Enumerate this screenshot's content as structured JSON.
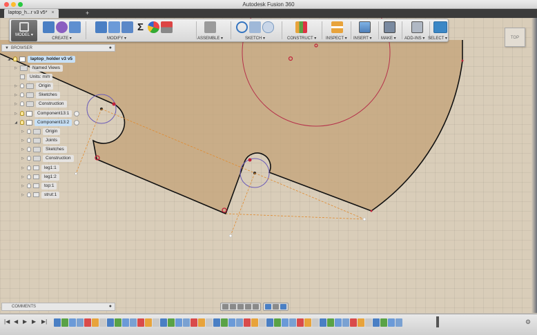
{
  "window": {
    "title": "Autodesk Fusion 360"
  },
  "tab": {
    "label": "laptop_h...r v3 v5*",
    "close": "×",
    "add": "+"
  },
  "toolbar": {
    "workspace": "MODEL ▾",
    "groups": [
      {
        "label": "CREATE ▾"
      },
      {
        "label": "MODIFY ▾"
      },
      {
        "label": "ASSEMBLE ▾"
      },
      {
        "label": "SKETCH ▾"
      },
      {
        "label": "CONSTRUCT ▾"
      },
      {
        "label": "INSPECT ▾"
      },
      {
        "label": "INSERT ▾"
      },
      {
        "label": "MAKE ▾"
      },
      {
        "label": "ADD-INS ▾"
      },
      {
        "label": "SELECT ▾"
      }
    ]
  },
  "viewcube": {
    "label": "TOP"
  },
  "browser": {
    "header": "BROWSER",
    "root": "laptop_holder v3 v5",
    "items": [
      {
        "label": "Named Views"
      },
      {
        "label": "Units: mm"
      },
      {
        "label": "Origin"
      },
      {
        "label": "Sketches"
      },
      {
        "label": "Construction"
      },
      {
        "label": "Component13:1"
      },
      {
        "label": "Component13:2"
      },
      {
        "label": "Origin"
      },
      {
        "label": "Joints"
      },
      {
        "label": "Sketches"
      },
      {
        "label": "Construction"
      },
      {
        "label": "leg1:1"
      },
      {
        "label": "leg1:2"
      },
      {
        "label": "top:1"
      },
      {
        "label": "strut:1"
      }
    ]
  },
  "comments": {
    "label": "COMMENTS"
  },
  "colors": {
    "plate": "#c4a57c",
    "edge": "#111111",
    "circle": "#b5304a",
    "construction": "#e08a2e",
    "select_accent": "#3b87c6"
  }
}
